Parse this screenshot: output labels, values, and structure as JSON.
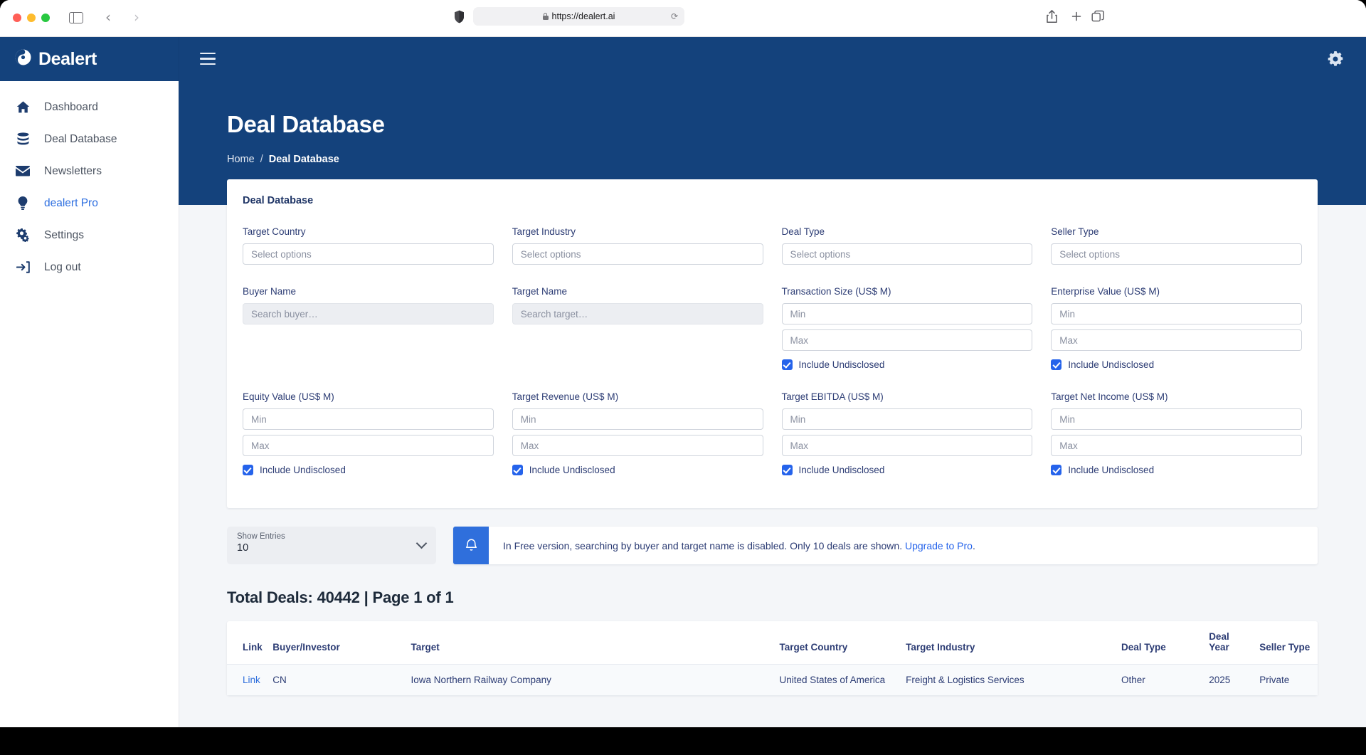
{
  "browser": {
    "url": "https://dealert.ai",
    "lock_icon": "lock-icon",
    "shield_icon": "shield-icon",
    "reload_icon": "reload-icon",
    "back_icon": "chevron-left-icon",
    "forward_icon": "chevron-right-icon",
    "sidebar_toggle_icon": "sidebar-toggle-icon",
    "share_icon": "share-icon",
    "new_tab_icon": "plus-icon",
    "tabs_icon": "tab-overview-icon"
  },
  "brand": {
    "name": "Dealert",
    "logo_icon": "dealert-logo-icon"
  },
  "sidebar": {
    "items": [
      {
        "label": "Dashboard",
        "icon": "home-icon",
        "active": false
      },
      {
        "label": "Deal Database",
        "icon": "database-icon",
        "active": false
      },
      {
        "label": "Newsletters",
        "icon": "envelope-icon",
        "active": false
      },
      {
        "label": "dealert Pro",
        "icon": "lightbulb-icon",
        "active": true
      },
      {
        "label": "Settings",
        "icon": "gears-icon",
        "active": false
      },
      {
        "label": "Log out",
        "icon": "logout-icon",
        "active": false
      }
    ]
  },
  "topbar": {
    "menu_icon": "hamburger-menu-icon",
    "settings_icon": "gear-icon"
  },
  "hero": {
    "title": "Deal Database",
    "breadcrumb": {
      "home": "Home",
      "separator": "/",
      "current": "Deal Database"
    }
  },
  "filters": {
    "card_title": "Deal Database",
    "row1": [
      {
        "label": "Target Country",
        "placeholder": "Select options",
        "name": "target-country"
      },
      {
        "label": "Target Industry",
        "placeholder": "Select options",
        "name": "target-industry"
      },
      {
        "label": "Deal Type",
        "placeholder": "Select options",
        "name": "deal-type"
      },
      {
        "label": "Seller Type",
        "placeholder": "Select options",
        "name": "seller-type"
      }
    ],
    "row2": [
      {
        "label": "Buyer Name",
        "placeholder": "Search buyer…",
        "type": "text-disabled"
      },
      {
        "label": "Target Name",
        "placeholder": "Search target…",
        "type": "text-disabled"
      },
      {
        "label": "Transaction Size (US$ M)",
        "min": "Min",
        "max": "Max",
        "checkbox": "Include Undisclosed",
        "checked": true
      },
      {
        "label": "Enterprise Value (US$ M)",
        "min": "Min",
        "max": "Max",
        "checkbox": "Include Undisclosed",
        "checked": true
      }
    ],
    "row3": [
      {
        "label": "Equity Value (US$ M)",
        "min": "Min",
        "max": "Max",
        "checkbox": "Include Undisclosed",
        "checked": true
      },
      {
        "label": "Target Revenue (US$ M)",
        "min": "Min",
        "max": "Max",
        "checkbox": "Include Undisclosed",
        "checked": true
      },
      {
        "label": "Target EBITDA (US$ M)",
        "min": "Min",
        "max": "Max",
        "checkbox": "Include Undisclosed",
        "checked": true
      },
      {
        "label": "Target Net Income (US$ M)",
        "min": "Min",
        "max": "Max",
        "checkbox": "Include Undisclosed",
        "checked": true
      }
    ]
  },
  "controls": {
    "show_entries_label": "Show Entries",
    "show_entries_value": "10",
    "caret_icon": "chevron-down-icon"
  },
  "alert": {
    "icon": "bell-icon",
    "text": "In Free version, searching by buyer and target name is disabled. Only 10 deals are shown.",
    "link_text": "Upgrade to Pro",
    "trailing": "."
  },
  "results": {
    "totals": "Total Deals: 40442 | Page 1 of 1",
    "columns": [
      "Link",
      "Buyer/Investor",
      "Target",
      "Target Country",
      "Target Industry",
      "Deal Type",
      "Deal Year",
      "Seller Type"
    ],
    "rows": [
      {
        "link": "Link",
        "buyer": "CN",
        "target": "Iowa Northern Railway Company",
        "country": "United States of America",
        "industry": "Freight & Logistics Services",
        "deal_type": "Other",
        "deal_year": "2025",
        "seller_type": "Private"
      }
    ]
  },
  "colors": {
    "navy": "#14427c",
    "accent_blue": "#2563eb",
    "link_blue": "#2f6fdc",
    "page_bg": "#f4f6f9",
    "label_navy": "#2c3c74"
  }
}
